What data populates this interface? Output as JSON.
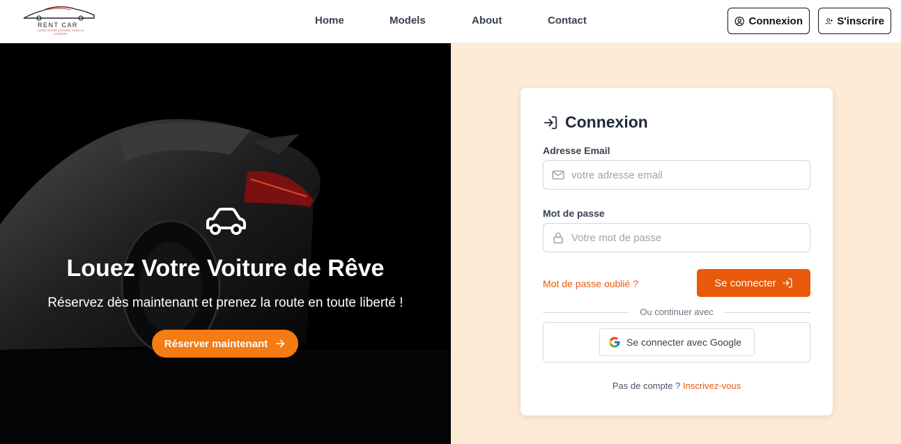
{
  "nav": {
    "logo": {
      "brand": "RENT CAR",
      "tagline": "LOUEZ VOTRE VOITURE, VIVEZ LE CONFORT"
    },
    "links": [
      "Home",
      "Models",
      "About",
      "Contact"
    ],
    "login_label": "Connexion",
    "signup_label": "S'inscrire"
  },
  "hero": {
    "title": "Louez Votre Voiture de Rêve",
    "subtitle": "Réservez dès maintenant et prenez la route en toute liberté !",
    "cta_label": "Réserver maintenant"
  },
  "login": {
    "title": "Connexion",
    "email_label": "Adresse Email",
    "email_placeholder": "votre adresse email",
    "password_label": "Mot de passe",
    "password_placeholder": "Votre mot de passe",
    "forgot_label": "Mot de passe oublié ?",
    "submit_label": "Se connecter",
    "divider_text": "Ou continuer avec",
    "google_label": "Se connecter avec Google",
    "no_account_text": "Pas de compte ?",
    "signup_link": "Inscrivez-vous"
  },
  "colors": {
    "accent": "#e8590c",
    "hero_button": "#f57c12",
    "right_background": "#fdebd5"
  },
  "icons": [
    "user-circle-icon",
    "user-plus-icon",
    "car-icon",
    "arrow-right-icon",
    "sign-in-icon",
    "envelope-icon",
    "lock-icon",
    "google-icon"
  ]
}
